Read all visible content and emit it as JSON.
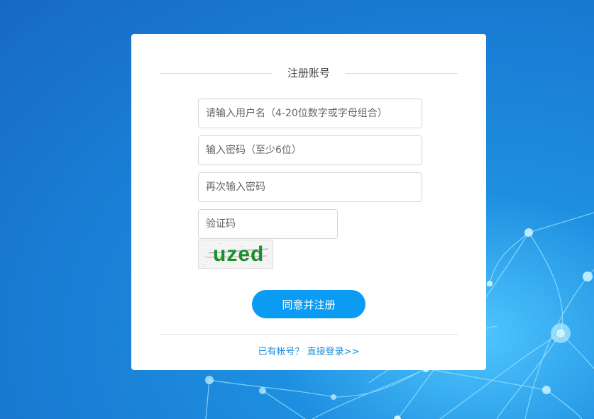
{
  "form": {
    "title": "注册账号",
    "username_placeholder": "请输入用户名（4-20位数字或字母组合）",
    "password_placeholder": "输入密码（至少6位）",
    "confirm_placeholder": "再次输入密码",
    "captcha_placeholder": "验证码",
    "captcha_text": "uzed",
    "submit_label": "同意并注册",
    "login_prompt": "已有帐号？",
    "login_link": "直接登录>>"
  },
  "colors": {
    "accent": "#0b9bf2",
    "link": "#1a8fe0",
    "captcha": "#1a8f2a"
  }
}
